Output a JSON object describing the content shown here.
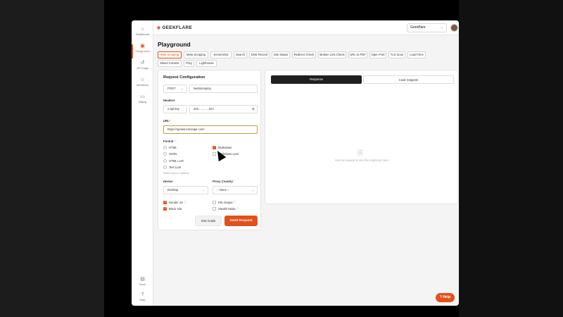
{
  "app": {
    "brand": "GEEKFLARE",
    "workspace": "Geekflare",
    "page_title": "Playground"
  },
  "sidebar": {
    "items": [
      {
        "label": "Dashboard",
        "icon": "home-icon"
      },
      {
        "label": "Playground",
        "icon": "code-icon",
        "active": true
      },
      {
        "label": "API Logs",
        "icon": "history-icon"
      },
      {
        "label": "Members",
        "icon": "users-icon"
      },
      {
        "label": "Billing",
        "icon": "card-icon"
      }
    ],
    "bottom": [
      {
        "label": "Docs",
        "icon": "doc-icon"
      },
      {
        "label": "Help",
        "icon": "help-icon"
      }
    ]
  },
  "tabs": [
    "Web Scraping",
    "Meta Scraping",
    "Screenshot",
    "Search",
    "DNS Record",
    "Site Status",
    "Redirect Check",
    "Broken Link Check",
    "URL to PDF",
    "Open Port",
    "TLS Scan",
    "Load Time",
    "Mixed Content",
    "Ping",
    "Lighthouse"
  ],
  "config": {
    "title": "Request Configuration",
    "method": "POST",
    "endpoint": "/webscraping",
    "headers_label": "Headers",
    "header_key": "x-api-key",
    "header_value": "323.............9CI",
    "url_label": "URL",
    "url_required": "*",
    "url_value": "https://quotes.toscrape.com/",
    "format_label": "Format",
    "formats_left": [
      "HTML",
      "JSON",
      "HTML LLM",
      "Text LLM"
    ],
    "formats_right": [
      "Markdown",
      "Markdown LLM"
    ],
    "format_hint": "Select up to 3 options",
    "device_label": "Device",
    "device_value": "Desktop",
    "proxy_label": "Proxy Country",
    "proxy_value": "-- None --",
    "options_left": [
      "Render JS",
      "Block Ads"
    ],
    "options_right": [
      "File Output",
      "Stealth Mode"
    ],
    "get_code": "Get Code",
    "send": "Send Request"
  },
  "response": {
    "tab_response": "Response",
    "tab_snippets": "Code Snippets",
    "empty": "Send a request to see the response here."
  },
  "help_label": "Help",
  "colors": {
    "accent": "#e2511b"
  }
}
